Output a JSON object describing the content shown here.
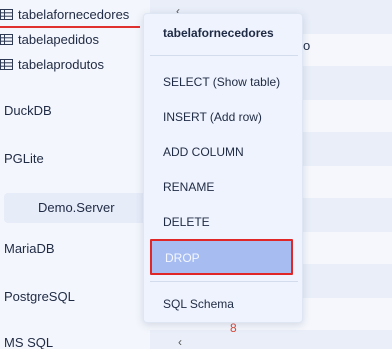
{
  "sidebar": {
    "tables": [
      {
        "label": "tabelafornecedores",
        "icon": "table-grid-icon",
        "active": true
      },
      {
        "label": "tabelapedidos",
        "icon": "table-grid-icon"
      },
      {
        "label": "tabelaprodutos",
        "icon": "table-grid-icon"
      }
    ],
    "databases": [
      {
        "label": "DuckDB"
      },
      {
        "label": "PGLite"
      },
      {
        "label": "MariaDB"
      },
      {
        "label": "PostgreSQL"
      },
      {
        "label": "MS SQL"
      }
    ],
    "server": {
      "label": "Demo.Server"
    }
  },
  "background": {
    "fragment": "o",
    "number": "8"
  },
  "context_menu": {
    "title": "tabelafornecedores",
    "items": [
      {
        "label": "SELECT (Show table)"
      },
      {
        "label": "INSERT (Add row)"
      },
      {
        "label": "ADD COLUMN"
      },
      {
        "label": "RENAME"
      },
      {
        "label": "DELETE"
      },
      {
        "label": "DROP",
        "highlighted": true
      },
      {
        "label": "SQL Schema"
      }
    ]
  },
  "colors": {
    "accent_red": "#e0312f",
    "highlight_blue": "#a7bdf2",
    "menu_bg": "#eef3fd"
  }
}
